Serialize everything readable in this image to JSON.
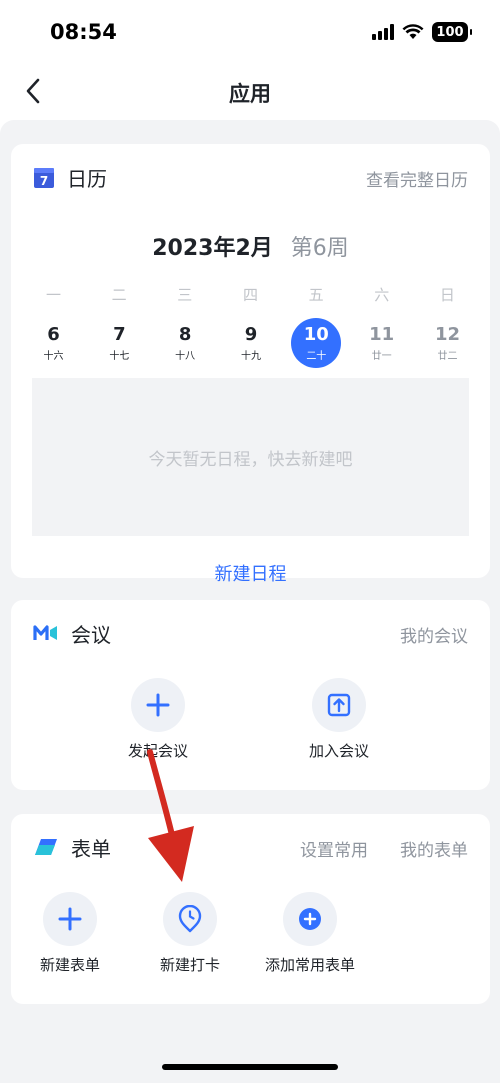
{
  "status_bar": {
    "time": "08:54",
    "battery": "100"
  },
  "nav": {
    "title": "应用"
  },
  "calendar": {
    "title": "日历",
    "view_full": "查看完整日历",
    "month": "2023年2月",
    "week": "第6周",
    "weekdays": [
      "一",
      "二",
      "三",
      "四",
      "五",
      "六",
      "日"
    ],
    "dates": [
      {
        "day": "6",
        "lunar": "十六"
      },
      {
        "day": "7",
        "lunar": "十七"
      },
      {
        "day": "8",
        "lunar": "十八"
      },
      {
        "day": "9",
        "lunar": "十九"
      },
      {
        "day": "10",
        "lunar": "二十"
      },
      {
        "day": "11",
        "lunar": "廿一"
      },
      {
        "day": "12",
        "lunar": "廿二"
      }
    ],
    "empty_text": "今天暂无日程，快去新建吧",
    "new_schedule": "新建日程"
  },
  "meeting": {
    "title": "会议",
    "my_meetings": "我的会议",
    "start_meeting": "发起会议",
    "join_meeting": "加入会议"
  },
  "form": {
    "title": "表单",
    "set_common": "设置常用",
    "my_forms": "我的表单",
    "new_form": "新建表单",
    "new_checkin": "新建打卡",
    "add_common_form": "添加常用表单"
  },
  "colors": {
    "accent": "#3370ff",
    "arrow": "#d32a20",
    "background": "#f2f3f5"
  }
}
